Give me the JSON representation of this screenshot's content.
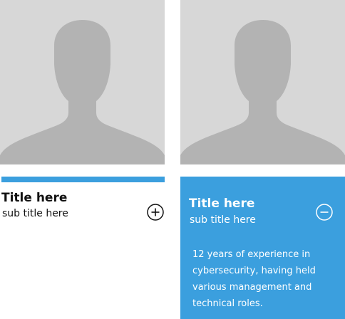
{
  "colors": {
    "accent": "#3b9fde",
    "photo_bg": "#d7d7d7",
    "silhouette": "#b3b3b3"
  },
  "cards": [
    {
      "title": "Title here",
      "subtitle": "sub title here",
      "toggle_icon": "plus-circle-icon",
      "expanded": false
    },
    {
      "title": "Title here",
      "subtitle": "sub title here",
      "toggle_icon": "minus-circle-icon",
      "expanded": true,
      "bio": "12 years of experience in cybersecurity, having held various management and technical roles."
    }
  ]
}
